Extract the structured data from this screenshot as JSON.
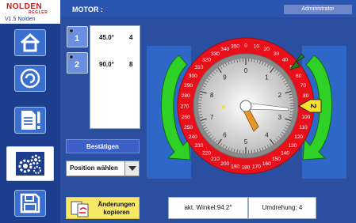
{
  "brand": {
    "name": "NOLDEN",
    "sub": "REGLER",
    "version": "V1.5 Nolden"
  },
  "sidebar": {
    "items": [
      {
        "name": "home",
        "icon": "home-icon"
      },
      {
        "name": "spiral",
        "icon": "spiral-icon"
      },
      {
        "name": "alarm",
        "icon": "alarm-document-icon"
      },
      {
        "name": "settings",
        "icon": "gears-icon",
        "active": true
      },
      {
        "name": "save",
        "icon": "floppy-disk-icon"
      }
    ]
  },
  "header": {
    "title": "MOTOR :",
    "user": "Administrator"
  },
  "positions": [
    {
      "number": "1",
      "angle": "45.0°",
      "value": "4"
    },
    {
      "number": "2",
      "angle": "90.0°",
      "value": "8"
    }
  ],
  "confirm_label": "Bestätigen",
  "select": {
    "selected": "Position wählen"
  },
  "copy_button": {
    "line1": "Änderungen",
    "line2": "kopieren"
  },
  "status": {
    "angle": "akt. Winkel:94.2°",
    "rotation": "Umdrehung: 4"
  },
  "dial": {
    "outer_labels": [
      "0",
      "10",
      "20",
      "30",
      "40",
      "50",
      "60",
      "70",
      "80",
      "90",
      "100",
      "110",
      "120",
      "130",
      "140",
      "150",
      "160",
      "170",
      "180",
      "190",
      "200",
      "210",
      "220",
      "230",
      "240",
      "250",
      "260",
      "270",
      "280",
      "290",
      "300",
      "310",
      "320",
      "330",
      "340",
      "350"
    ],
    "inner_labels": [
      "0",
      "1",
      "2",
      "3",
      "4",
      "5",
      "6",
      "7",
      "8",
      "9"
    ],
    "current_angle": 94.2,
    "marker_label": "2",
    "colors": {
      "ring": "#e8101a",
      "arrows": "#2fd126",
      "side_panels": "#2f67c9",
      "marker": "#f7e02b",
      "pointer": "#e5962a"
    }
  }
}
